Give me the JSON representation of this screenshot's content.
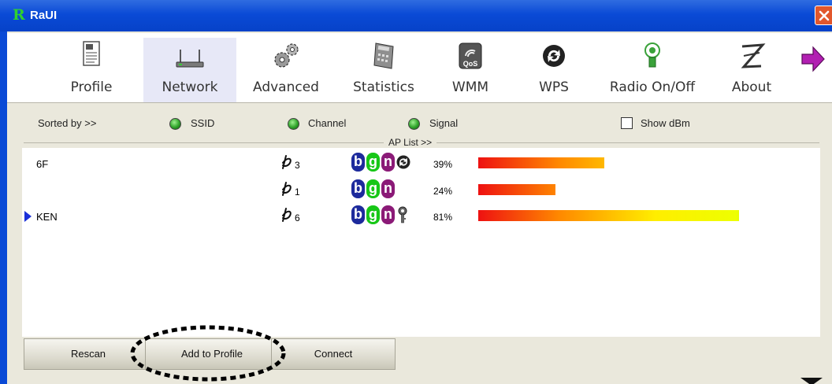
{
  "window": {
    "logo": "R",
    "title": "RaUI"
  },
  "toolbar": {
    "items": [
      {
        "label": "Profile",
        "icon": "profile-icon"
      },
      {
        "label": "Network",
        "icon": "network-router-icon",
        "active": true
      },
      {
        "label": "Advanced",
        "icon": "gears-icon"
      },
      {
        "label": "Statistics",
        "icon": "calculator-icon"
      },
      {
        "label": "WMM",
        "icon": "qos-icon",
        "badge": "QoS"
      },
      {
        "label": "WPS",
        "icon": "wps-icon"
      },
      {
        "label": "Radio On/Off",
        "icon": "radio-antenna-icon"
      },
      {
        "label": "About",
        "icon": "about-icon"
      }
    ],
    "next": "next-arrow-icon"
  },
  "sort": {
    "label": "Sorted by >>",
    "options": [
      "SSID",
      "Channel",
      "Signal"
    ],
    "show_dbm": {
      "label": "Show dBm",
      "checked": false
    }
  },
  "ap_list": {
    "title": "AP List >>",
    "rows": [
      {
        "ssid": "6F",
        "channel": "3",
        "modes": [
          "b",
          "g",
          "n"
        ],
        "extra": "wps",
        "signal": "39%",
        "signal_value": 39,
        "selected": false
      },
      {
        "ssid": "",
        "channel": "1",
        "modes": [
          "b",
          "g",
          "n"
        ],
        "extra": "",
        "signal": "24%",
        "signal_value": 24,
        "selected": false
      },
      {
        "ssid": "KEN",
        "channel": "6",
        "modes": [
          "b",
          "g",
          "n"
        ],
        "extra": "key",
        "signal": "81%",
        "signal_value": 81,
        "selected": true
      }
    ]
  },
  "buttons": {
    "rescan": "Rescan",
    "add_to_profile": "Add to Profile",
    "connect": "Connect"
  },
  "colors": {
    "titlebar": "#0a4ad6",
    "accent_selected": "#1a2fd8",
    "mode_b": "#1d2a9c",
    "mode_g": "#17c717",
    "mode_n": "#8b1a77"
  }
}
